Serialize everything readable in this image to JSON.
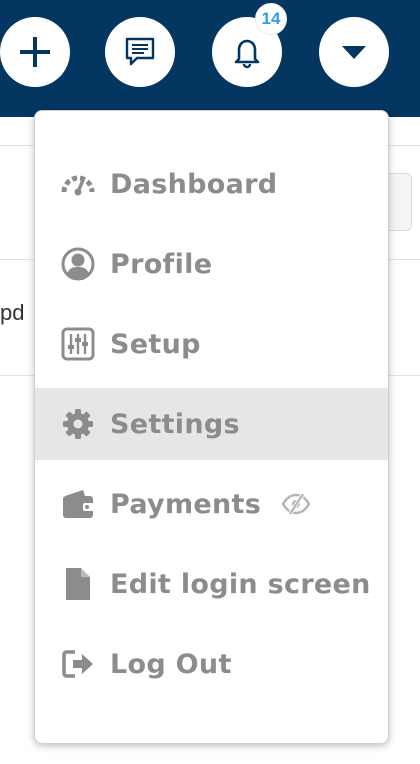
{
  "header": {
    "notification_count": "14",
    "colors": {
      "bar": "#033660",
      "badge_text": "#2e9fe6"
    }
  },
  "background": {
    "partial_text": "pd"
  },
  "menu": {
    "items": [
      {
        "label": "Dashboard",
        "icon": "speedometer-icon"
      },
      {
        "label": "Profile",
        "icon": "user-circle-icon"
      },
      {
        "label": "Setup",
        "icon": "sliders-icon"
      },
      {
        "label": "Settings",
        "icon": "gear-icon",
        "active": true
      },
      {
        "label": "Payments",
        "icon": "wallet-icon",
        "extra_icon": "eye-slash-icon"
      },
      {
        "label": "Edit login screen",
        "icon": "document-icon"
      },
      {
        "label": "Log Out",
        "icon": "sign-out-icon"
      }
    ],
    "colors": {
      "label": "#8c8c8c",
      "active_bg": "#e6e6e6"
    }
  }
}
